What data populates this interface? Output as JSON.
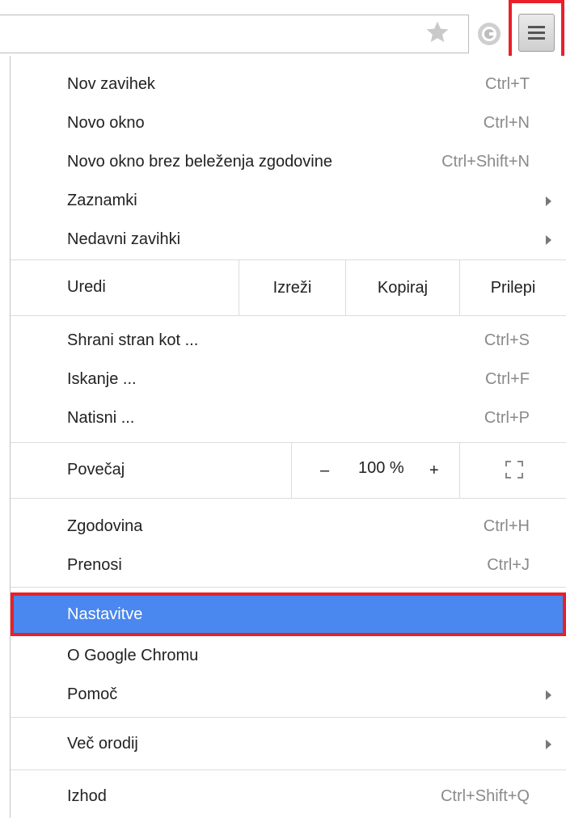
{
  "menu": {
    "items_top": [
      {
        "label": "Nov zavihek",
        "shortcut": "Ctrl+T"
      },
      {
        "label": "Novo okno",
        "shortcut": "Ctrl+N"
      },
      {
        "label": "Novo okno brez beleženja zgodovine",
        "shortcut": "Ctrl+Shift+N"
      },
      {
        "label": "Zaznamki",
        "submenu": true
      },
      {
        "label": "Nedavni zavihki",
        "submenu": true
      }
    ],
    "edit": {
      "label": "Uredi",
      "cut": "Izreži",
      "copy": "Kopiraj",
      "paste": "Prilepi"
    },
    "items_page": [
      {
        "label": "Shrani stran kot ...",
        "shortcut": "Ctrl+S"
      },
      {
        "label": "Iskanje ...",
        "shortcut": "Ctrl+F"
      },
      {
        "label": "Natisni ...",
        "shortcut": "Ctrl+P"
      }
    ],
    "zoom": {
      "label": "Povečaj",
      "minus": "–",
      "value": "100 %",
      "plus": "+"
    },
    "items_history": [
      {
        "label": "Zgodovina",
        "shortcut": "Ctrl+H"
      },
      {
        "label": "Prenosi",
        "shortcut": "Ctrl+J"
      }
    ],
    "items_settings": [
      {
        "label": "Nastavitve",
        "highlighted": true
      },
      {
        "label": "O Google Chromu"
      },
      {
        "label": "Pomoč",
        "submenu": true
      }
    ],
    "more_tools": {
      "label": "Več orodij",
      "submenu": true
    },
    "exit": {
      "label": "Izhod",
      "shortcut": "Ctrl+Shift+Q"
    }
  },
  "colors": {
    "highlight": "#4a87ee",
    "callout": "#e8202a",
    "shortcut_text": "#8a8a8a"
  }
}
